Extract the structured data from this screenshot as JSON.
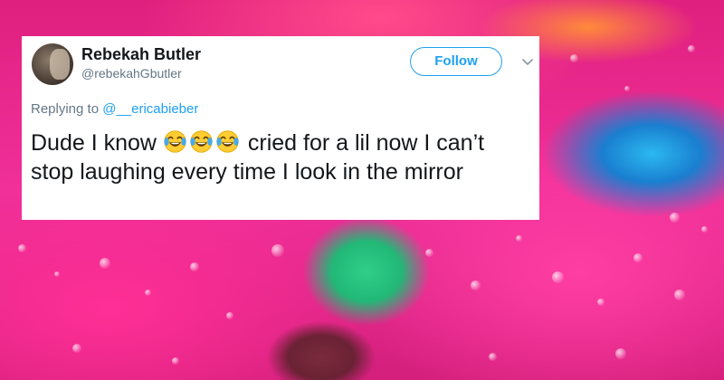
{
  "tweet": {
    "author_name": "Rebekah Butler",
    "author_handle": "@rebekahGbutler",
    "follow_label": "Follow",
    "reply_prefix": "Replying to ",
    "reply_mention": "@__ericabieber",
    "text_before_emoji": "Dude I know ",
    "emoji_name": "face-with-tears-of-joy-icon",
    "emoji_count": 3,
    "text_after_emoji": " cried for a lil now I can’t stop laughing every time I look in the mirror"
  },
  "colors": {
    "twitter_blue": "#1da1f2",
    "text_primary": "#14171a",
    "text_secondary": "#657786"
  }
}
